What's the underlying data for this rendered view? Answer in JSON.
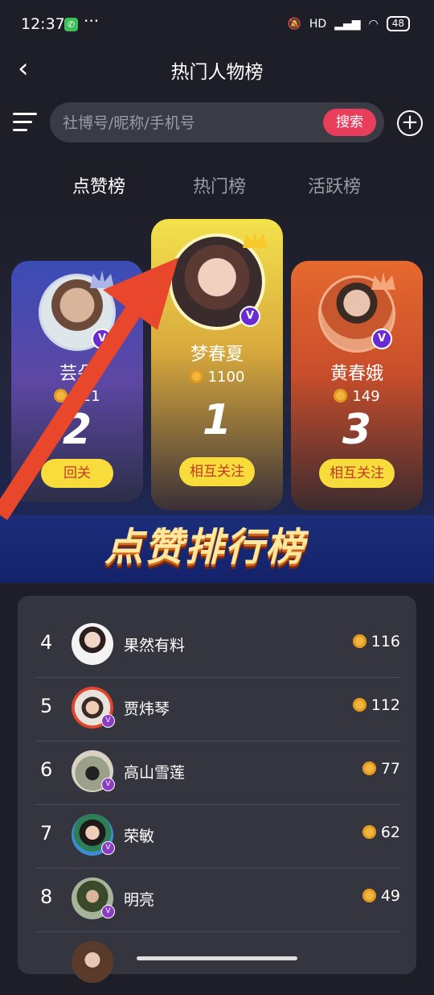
{
  "status": {
    "time": "12:37",
    "battery": "48",
    "network": "HD"
  },
  "header": {
    "title": "热门人物榜"
  },
  "search": {
    "placeholder": "社博号/昵称/手机号",
    "button": "搜索"
  },
  "tabs": [
    {
      "label": "点赞榜"
    },
    {
      "label": "热门榜"
    },
    {
      "label": "活跃榜"
    }
  ],
  "podium": [
    {
      "rank": "2",
      "name": "芸朵",
      "likes": "121",
      "button": "回关"
    },
    {
      "rank": "1",
      "name": "梦春夏",
      "likes": "1100",
      "button": "相互关注"
    },
    {
      "rank": "3",
      "name": "黄春娥",
      "likes": "149",
      "button": "相互关注"
    }
  ],
  "banner": "点赞排行榜",
  "list": [
    {
      "rank": "4",
      "name": "果然有料",
      "likes": "116"
    },
    {
      "rank": "5",
      "name": "贾炜琴",
      "likes": "112"
    },
    {
      "rank": "6",
      "name": "高山雪莲",
      "likes": "77"
    },
    {
      "rank": "7",
      "name": "荣敏",
      "likes": "62"
    },
    {
      "rank": "8",
      "name": "明亮",
      "likes": "49"
    }
  ],
  "colors": {
    "accent": "#e83e5c",
    "gold": "#f7dc3c",
    "arrow": "#e8472c"
  }
}
